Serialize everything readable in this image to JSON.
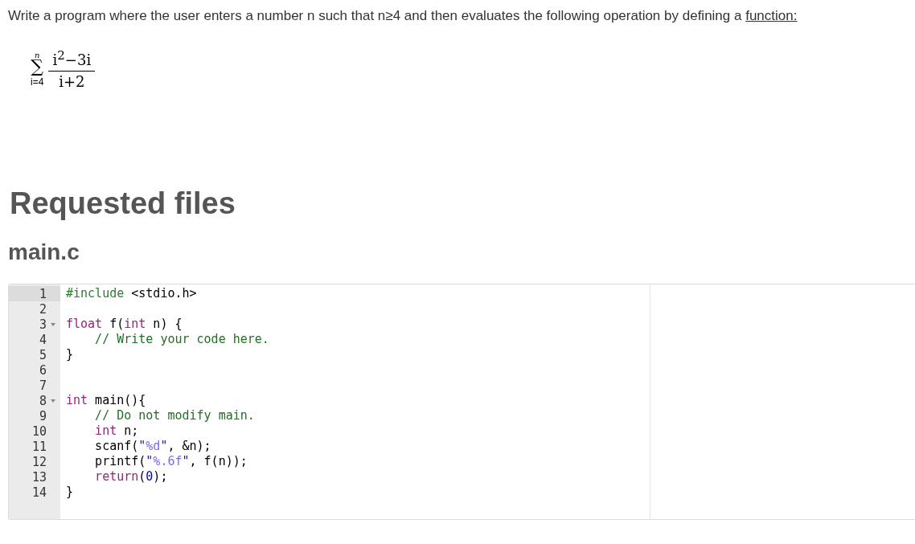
{
  "prompt": {
    "text": "Write a program where the user enters a number n such that n≥4 and then evaluates the following operation by defining a",
    "link": "function:"
  },
  "formula": {
    "upper": "n",
    "lower": "i=4",
    "symbol": "∑",
    "numerator": "i$^{2}$−3i",
    "denominator": "i+2"
  },
  "heading": "Requested files",
  "file": {
    "name": "main.c",
    "lines": [
      {
        "number": "1",
        "active": true,
        "foldable": false,
        "indent": false,
        "tokens": [
          {
            "kind": "directive",
            "text": "#include"
          },
          {
            "kind": "plain",
            "text": " <stdio.h>"
          }
        ]
      },
      {
        "number": "2",
        "active": false,
        "foldable": false,
        "indent": false
      },
      {
        "number": "3",
        "active": false,
        "foldable": true,
        "indent": false,
        "tokens": [
          {
            "kind": "keyword",
            "text": "float"
          },
          {
            "kind": "plain",
            "text": " f("
          },
          {
            "kind": "keyword",
            "text": "int"
          },
          {
            "kind": "plain",
            "text": " n) {"
          }
        ]
      },
      {
        "number": "4",
        "active": false,
        "foldable": false,
        "indent": true,
        "tokens": [
          {
            "kind": "comment",
            "text": "// Write your code here."
          }
        ]
      },
      {
        "number": "5",
        "active": false,
        "foldable": false,
        "indent": false,
        "tokens": [
          {
            "kind": "plain",
            "text": "}"
          }
        ]
      },
      {
        "number": "6",
        "active": false,
        "foldable": false,
        "indent": false
      },
      {
        "number": "7",
        "active": false,
        "foldable": false,
        "indent": false
      },
      {
        "number": "8",
        "active": false,
        "foldable": true,
        "indent": false,
        "tokens": [
          {
            "kind": "keyword",
            "text": "int"
          },
          {
            "kind": "plain",
            "text": " main(){"
          }
        ]
      },
      {
        "number": "9",
        "active": false,
        "foldable": false,
        "indent": true,
        "tokens": [
          {
            "kind": "comment",
            "text": "// Do not modify main."
          }
        ]
      },
      {
        "number": "10",
        "active": false,
        "foldable": false,
        "indent": true,
        "tokens": [
          {
            "kind": "keyword",
            "text": "int"
          },
          {
            "kind": "plain",
            "text": " n;"
          }
        ]
      },
      {
        "number": "11",
        "active": false,
        "foldable": false,
        "indent": true,
        "tokens": [
          {
            "kind": "plain",
            "text": "scanf("
          },
          {
            "kind": "string",
            "text": "\""
          },
          {
            "kind": "format",
            "text": "%d"
          },
          {
            "kind": "string",
            "text": "\""
          },
          {
            "kind": "plain",
            "text": ", &n);"
          }
        ]
      },
      {
        "number": "12",
        "active": false,
        "foldable": false,
        "indent": true,
        "tokens": [
          {
            "kind": "plain",
            "text": "printf("
          },
          {
            "kind": "string",
            "text": "\""
          },
          {
            "kind": "format",
            "text": "%.6f"
          },
          {
            "kind": "string",
            "text": "\""
          },
          {
            "kind": "plain",
            "text": ", f(n));"
          }
        ]
      },
      {
        "number": "13",
        "active": false,
        "foldable": false,
        "indent": true,
        "tokens": [
          {
            "kind": "keyword",
            "text": "return"
          },
          {
            "kind": "plain",
            "text": "("
          },
          {
            "kind": "number",
            "text": "0"
          },
          {
            "kind": "plain",
            "text": ");"
          }
        ]
      },
      {
        "number": "14",
        "active": false,
        "foldable": false,
        "indent": false,
        "tokens": [
          {
            "kind": "plain",
            "text": "}"
          }
        ]
      }
    ]
  }
}
